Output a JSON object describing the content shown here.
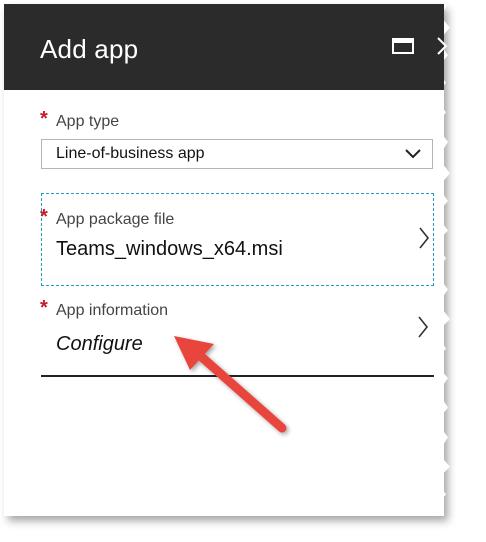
{
  "header": {
    "title": "Add app",
    "maximize_icon": "maximize-icon",
    "close_icon": "chevron-right-icon",
    "background": "#2b2b2b"
  },
  "form": {
    "required_marker": "*",
    "app_type": {
      "label": "App type",
      "value": "Line-of-business app"
    },
    "app_package": {
      "label": "App package file",
      "value": "Teams_windows_x64.msi"
    },
    "app_information": {
      "label": "App information",
      "value": "Configure"
    }
  },
  "annotation": {
    "arrow_color": "#e8453c",
    "points_to": "app-information-configure"
  },
  "colors": {
    "required": "#c41c28",
    "focus_border": "#1c9fc0"
  }
}
